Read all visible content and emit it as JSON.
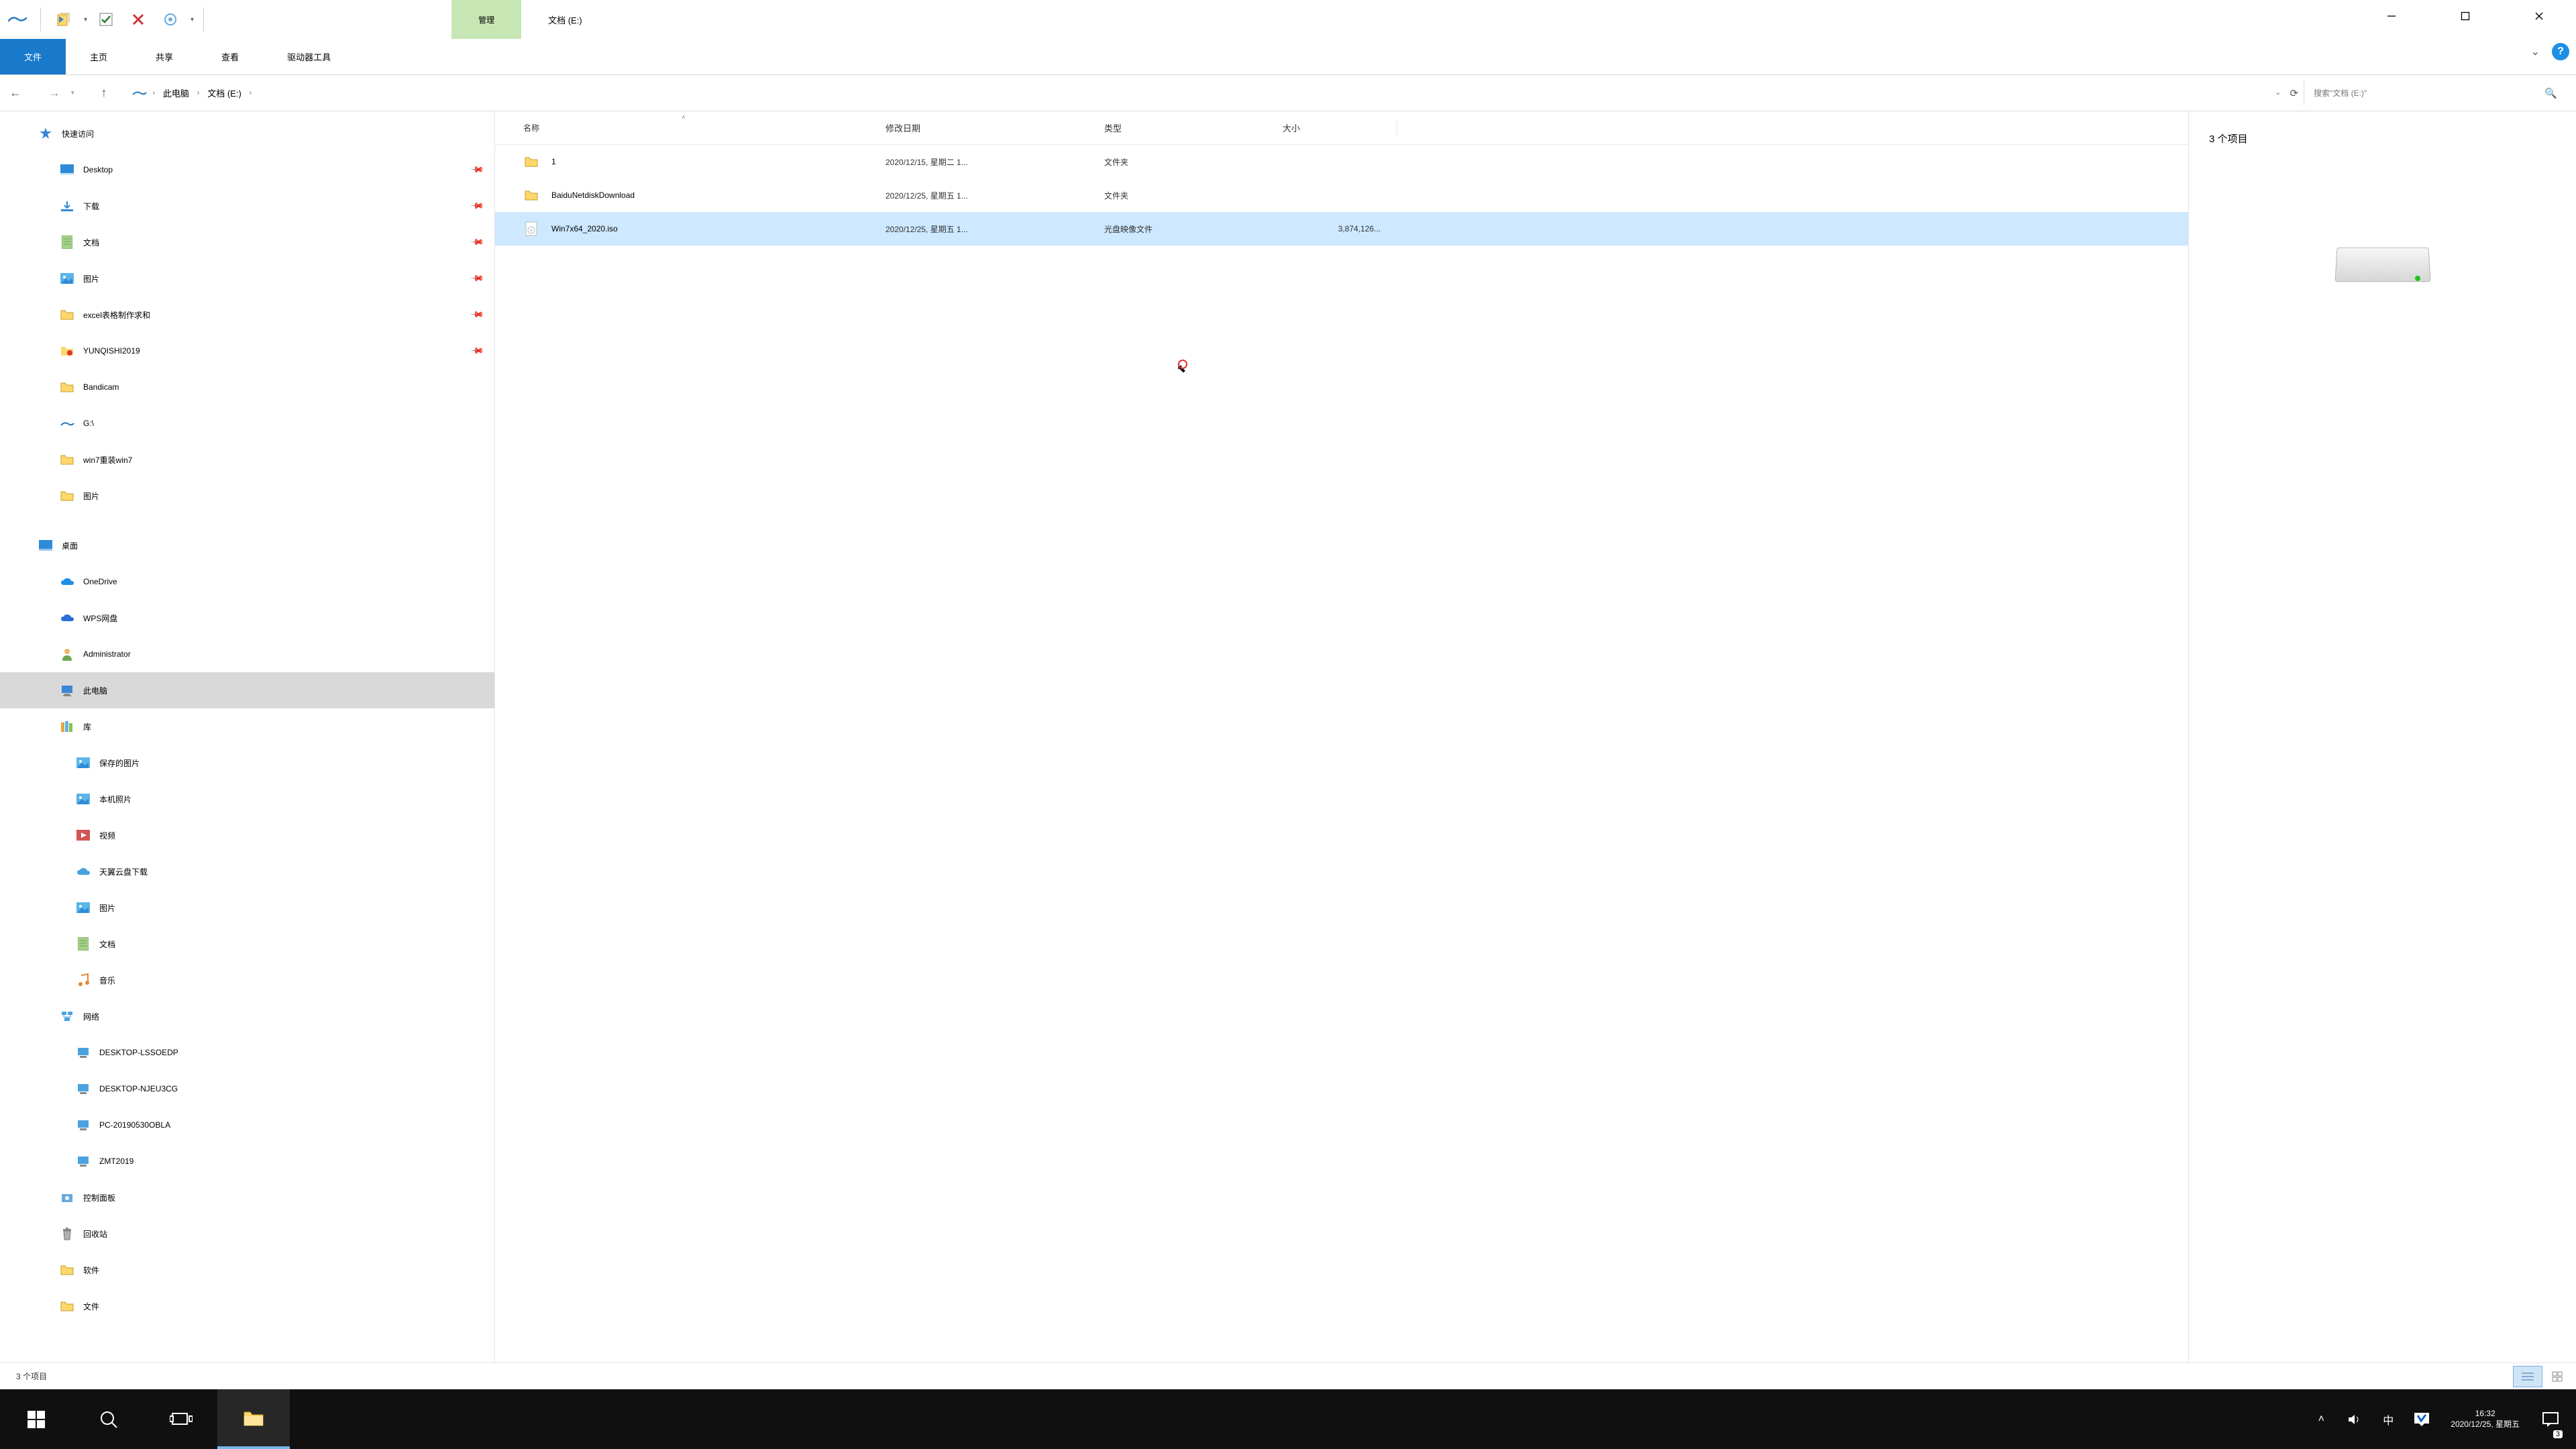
{
  "titlebar": {
    "manage_tab": "管理",
    "title": "文档 (E:)"
  },
  "ribbon": {
    "file": "文件",
    "home": "主页",
    "share": "共享",
    "view": "查看",
    "drive_tools": "驱动器工具"
  },
  "address": {
    "crumbs": [
      "此电脑",
      "文档 (E:)"
    ],
    "search_placeholder": "搜索\"文档 (E:)\""
  },
  "nav": {
    "quick": "快速访问",
    "quick_items": [
      {
        "label": "Desktop",
        "pin": true,
        "icon": "desktop"
      },
      {
        "label": "下载",
        "pin": true,
        "icon": "downloads"
      },
      {
        "label": "文档",
        "pin": true,
        "icon": "documents"
      },
      {
        "label": "图片",
        "pin": true,
        "icon": "pictures"
      },
      {
        "label": "excel表格制作求和",
        "pin": true,
        "icon": "folder"
      },
      {
        "label": "YUNQISHI2019",
        "pin": true,
        "icon": "folder-yq"
      },
      {
        "label": "Bandicam",
        "pin": false,
        "icon": "folder"
      },
      {
        "label": "G:\\",
        "pin": false,
        "icon": "drive-g"
      },
      {
        "label": "win7重装win7",
        "pin": false,
        "icon": "folder"
      },
      {
        "label": "图片",
        "pin": false,
        "icon": "folder"
      }
    ],
    "desktops": {
      "label": "桌面",
      "items": [
        {
          "label": "OneDrive",
          "icon": "onedrive"
        },
        {
          "label": "WPS网盘",
          "icon": "wps"
        },
        {
          "label": "Administrator",
          "icon": "user"
        },
        {
          "label": "此电脑",
          "icon": "pc",
          "selected": true
        },
        {
          "label": "库",
          "icon": "libs"
        }
      ]
    },
    "libs": [
      {
        "label": "保存的图片",
        "icon": "pictures"
      },
      {
        "label": "本机照片",
        "icon": "pictures"
      },
      {
        "label": "视频",
        "icon": "videos"
      },
      {
        "label": "天翼云盘下载",
        "icon": "tianyi"
      },
      {
        "label": "图片",
        "icon": "pictures"
      },
      {
        "label": "文档",
        "icon": "documents"
      },
      {
        "label": "音乐",
        "icon": "music"
      }
    ],
    "network": {
      "label": "网络",
      "items": [
        "DESKTOP-LSSOEDP",
        "DESKTOP-NJEU3CG",
        "PC-20190530OBLA",
        "ZMT2019"
      ]
    },
    "others": [
      "控制面板",
      "回收站",
      "软件",
      "文件"
    ]
  },
  "columns": {
    "name": "名称",
    "date": "修改日期",
    "type": "类型",
    "size": "大小"
  },
  "rows": [
    {
      "name": "1",
      "date": "2020/12/15, 星期二 1...",
      "type": "文件夹",
      "size": "",
      "icon": "folder"
    },
    {
      "name": "BaiduNetdiskDownload",
      "date": "2020/12/25, 星期五 1...",
      "type": "文件夹",
      "size": "",
      "icon": "folder"
    },
    {
      "name": "Win7x64_2020.iso",
      "date": "2020/12/25, 星期五 1...",
      "type": "光盘映像文件",
      "size": "3,874,126...",
      "icon": "iso",
      "selected": true
    }
  ],
  "preview": {
    "count": "3 个项目"
  },
  "statusbar": {
    "text": "3 个项目"
  },
  "tray": {
    "time": "16:32",
    "date": "2020/12/25, 星期五",
    "ime": "中",
    "notif_badge": "3"
  }
}
